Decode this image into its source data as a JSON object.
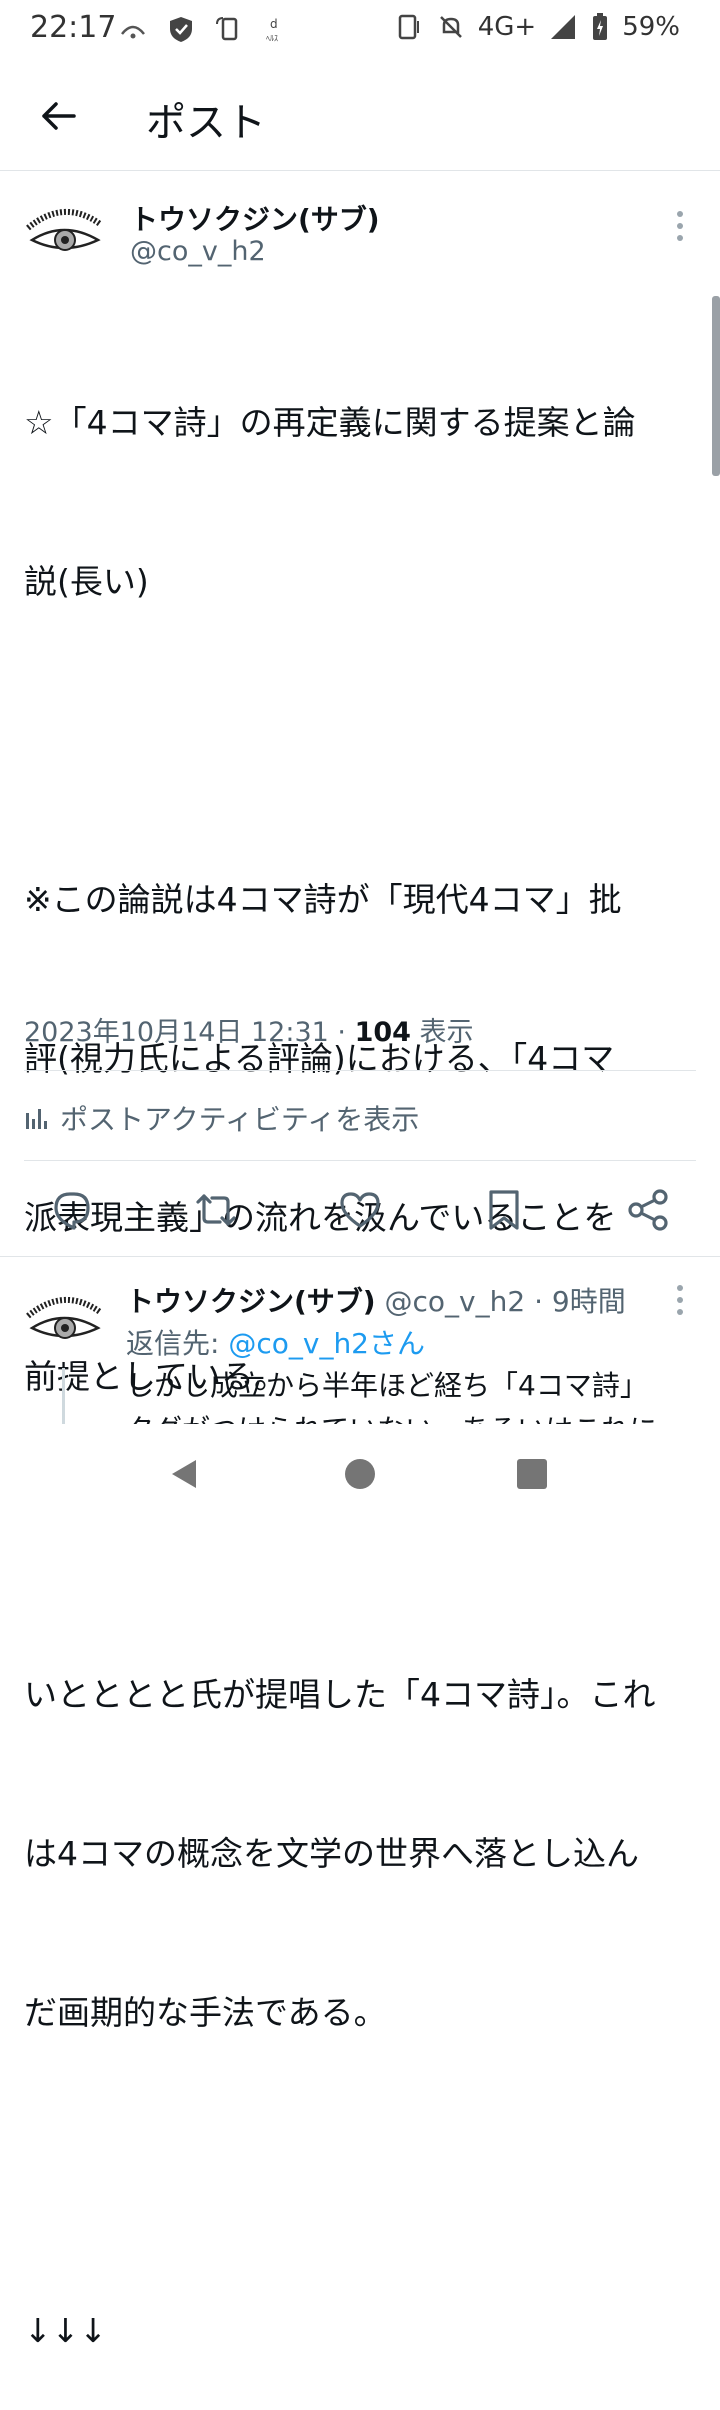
{
  "status_bar": {
    "time": "22:17",
    "network": "4G+",
    "battery": "59%"
  },
  "header": {
    "title": "ポスト"
  },
  "tweet": {
    "author_name": "トウソクジン(サブ)",
    "author_handle": "@co_v_h2",
    "lines": [
      "☆「4コマ詩」の再定義に関する提案と論",
      "説(長い)",
      "",
      "※この論説は4コマ詩が「現代4コマ」批",
      "評(視力氏による評論)における、「4コマ",
      "派表現主義」の流れを汲んでいることを",
      "前提としている。",
      "",
      "いとととと氏が提唱した「4コマ詩」。これ",
      "は4コマの概念を文学の世界へ落とし込ん",
      "だ画期的な手法である。",
      "",
      "↓↓↓"
    ],
    "datetime": "2023年10月14日 12:31",
    "separator": " · ",
    "views_count": "104",
    "views_label": " 表示",
    "activity_label": "ポストアクティビティを表示"
  },
  "reply": {
    "author_name": "トウソクジン(サブ)",
    "author_handle": " @co_v_h2",
    "time": " · 9時間",
    "reply_to_prefix": "返信先: ",
    "reply_to_handle": "@co_v_h2さん",
    "text_line1": "しかし成立から半年ほど経ち「4コマ詩」",
    "text_line2": "タグがつけられていない、あるいはこれに"
  },
  "colors": {
    "text_primary": "#0f1419",
    "text_secondary": "#536471",
    "link": "#1d9bf0",
    "divider": "#e1e5e8"
  },
  "icons": {
    "back": "arrow-left-icon",
    "more": "more-vertical-icon",
    "reply": "reply-icon",
    "retweet": "retweet-icon",
    "like": "heart-icon",
    "bookmark": "bookmark-icon",
    "share": "share-icon",
    "activity": "bar-chart-icon"
  }
}
